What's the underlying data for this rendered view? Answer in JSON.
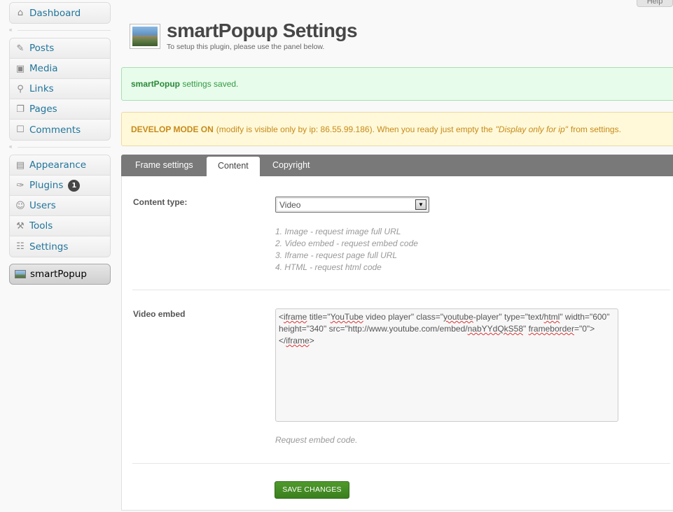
{
  "help_label": "Help",
  "sidebar": {
    "group1": [
      {
        "label": "Dashboard",
        "icon": "house-icon"
      }
    ],
    "group2": [
      {
        "label": "Posts",
        "icon": "pin-icon"
      },
      {
        "label": "Media",
        "icon": "media-icon"
      },
      {
        "label": "Links",
        "icon": "chain-icon"
      },
      {
        "label": "Pages",
        "icon": "pages-icon"
      },
      {
        "label": "Comments",
        "icon": "speech-bubble-icon"
      }
    ],
    "group3": [
      {
        "label": "Appearance",
        "icon": "appearance-icon"
      },
      {
        "label": "Plugins",
        "icon": "plug-icon",
        "badge": "1"
      },
      {
        "label": "Users",
        "icon": "users-icon"
      },
      {
        "label": "Tools",
        "icon": "tools-icon"
      },
      {
        "label": "Settings",
        "icon": "settings-icon"
      }
    ],
    "active": {
      "label": "smartPopup",
      "icon": "image-icon"
    }
  },
  "header": {
    "title": "smartPopup Settings",
    "subtitle": "To setup this plugin, please use the panel below."
  },
  "notices": {
    "saved_strong": "smartPopup",
    "saved_text": " settings saved.",
    "dev_strong": "DEVELOP MODE ON",
    "dev_text_1": "(modify is visible only by ip: 86.55.99.186). When you ready just empty the",
    "dev_emph": "\"Display only for ip\"",
    "dev_text_2": "from settings."
  },
  "tabs": [
    "Frame settings",
    "Content",
    "Copyright"
  ],
  "content": {
    "type_label": "Content type:",
    "type_value": "Video",
    "type_hints": [
      "1. Image - request image full URL",
      "2. Video embed - request embed code",
      "3. Iframe - request page full URL",
      "4. HTML - request html code"
    ],
    "embed_label": "Video embed",
    "embed_part1": "<",
    "embed_w1": "iframe",
    "embed_part2": " title=\"",
    "embed_w2": "YouTube",
    "embed_part3": " video player\" class=\"",
    "embed_w3": "youtube",
    "embed_part4": "-player\" type=\"text/",
    "embed_w4": "html",
    "embed_part5": "\" width=\"600\" height=\"340\" src=\"http://www.youtube.com/embed/",
    "embed_w5": "nabYYdQkS58",
    "embed_part6": "\" ",
    "embed_w6": "frameborder",
    "embed_part7": "=\"0\"></",
    "embed_w7": "iframe",
    "embed_part8": ">",
    "embed_help": "Request embed code.",
    "save_label": "SAVE CHANGES"
  }
}
